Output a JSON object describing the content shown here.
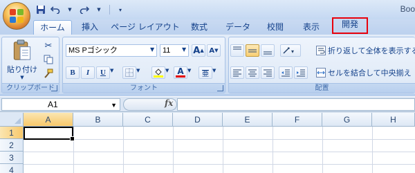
{
  "title_bar": {
    "app_title": "Book"
  },
  "quick_access": {
    "items": [
      "save-icon",
      "undo-icon",
      "redo-icon",
      "customize-icon"
    ]
  },
  "tabs": [
    {
      "label": "ホーム",
      "active": true
    },
    {
      "label": "挿入"
    },
    {
      "label": "ページ レイアウト"
    },
    {
      "label": "数式"
    },
    {
      "label": "データ"
    },
    {
      "label": "校閲"
    },
    {
      "label": "表示"
    },
    {
      "label": "開発",
      "highlighted": true
    }
  ],
  "ribbon": {
    "clipboard": {
      "paste_label": "貼り付け",
      "group_label": "クリップボード"
    },
    "font": {
      "font_name": "MS Pゴシック",
      "font_size": "11",
      "bold": "B",
      "italic": "I",
      "underline": "U",
      "grow": "A",
      "shrink": "A",
      "font_color_letter": "A",
      "phonetic": "亜",
      "group_label": "フォント"
    },
    "alignment": {
      "wrap_text": "折り返して全体を表示する",
      "merge_center": "セルを結合して中央揃え",
      "group_label": "配置"
    }
  },
  "formula_bar": {
    "name_box": "A1",
    "fx": "fx",
    "formula": ""
  },
  "grid": {
    "columns": [
      "A",
      "B",
      "C",
      "D",
      "E",
      "F",
      "G",
      "H"
    ],
    "rows": [
      "1",
      "2",
      "3",
      "4"
    ],
    "active_cell": "A1"
  },
  "colors": {
    "highlight_border": "#e8000b",
    "selected_header": "#f7c86b",
    "font_color_bar": "#e30000",
    "fill_color_bar": "#ffff00"
  }
}
